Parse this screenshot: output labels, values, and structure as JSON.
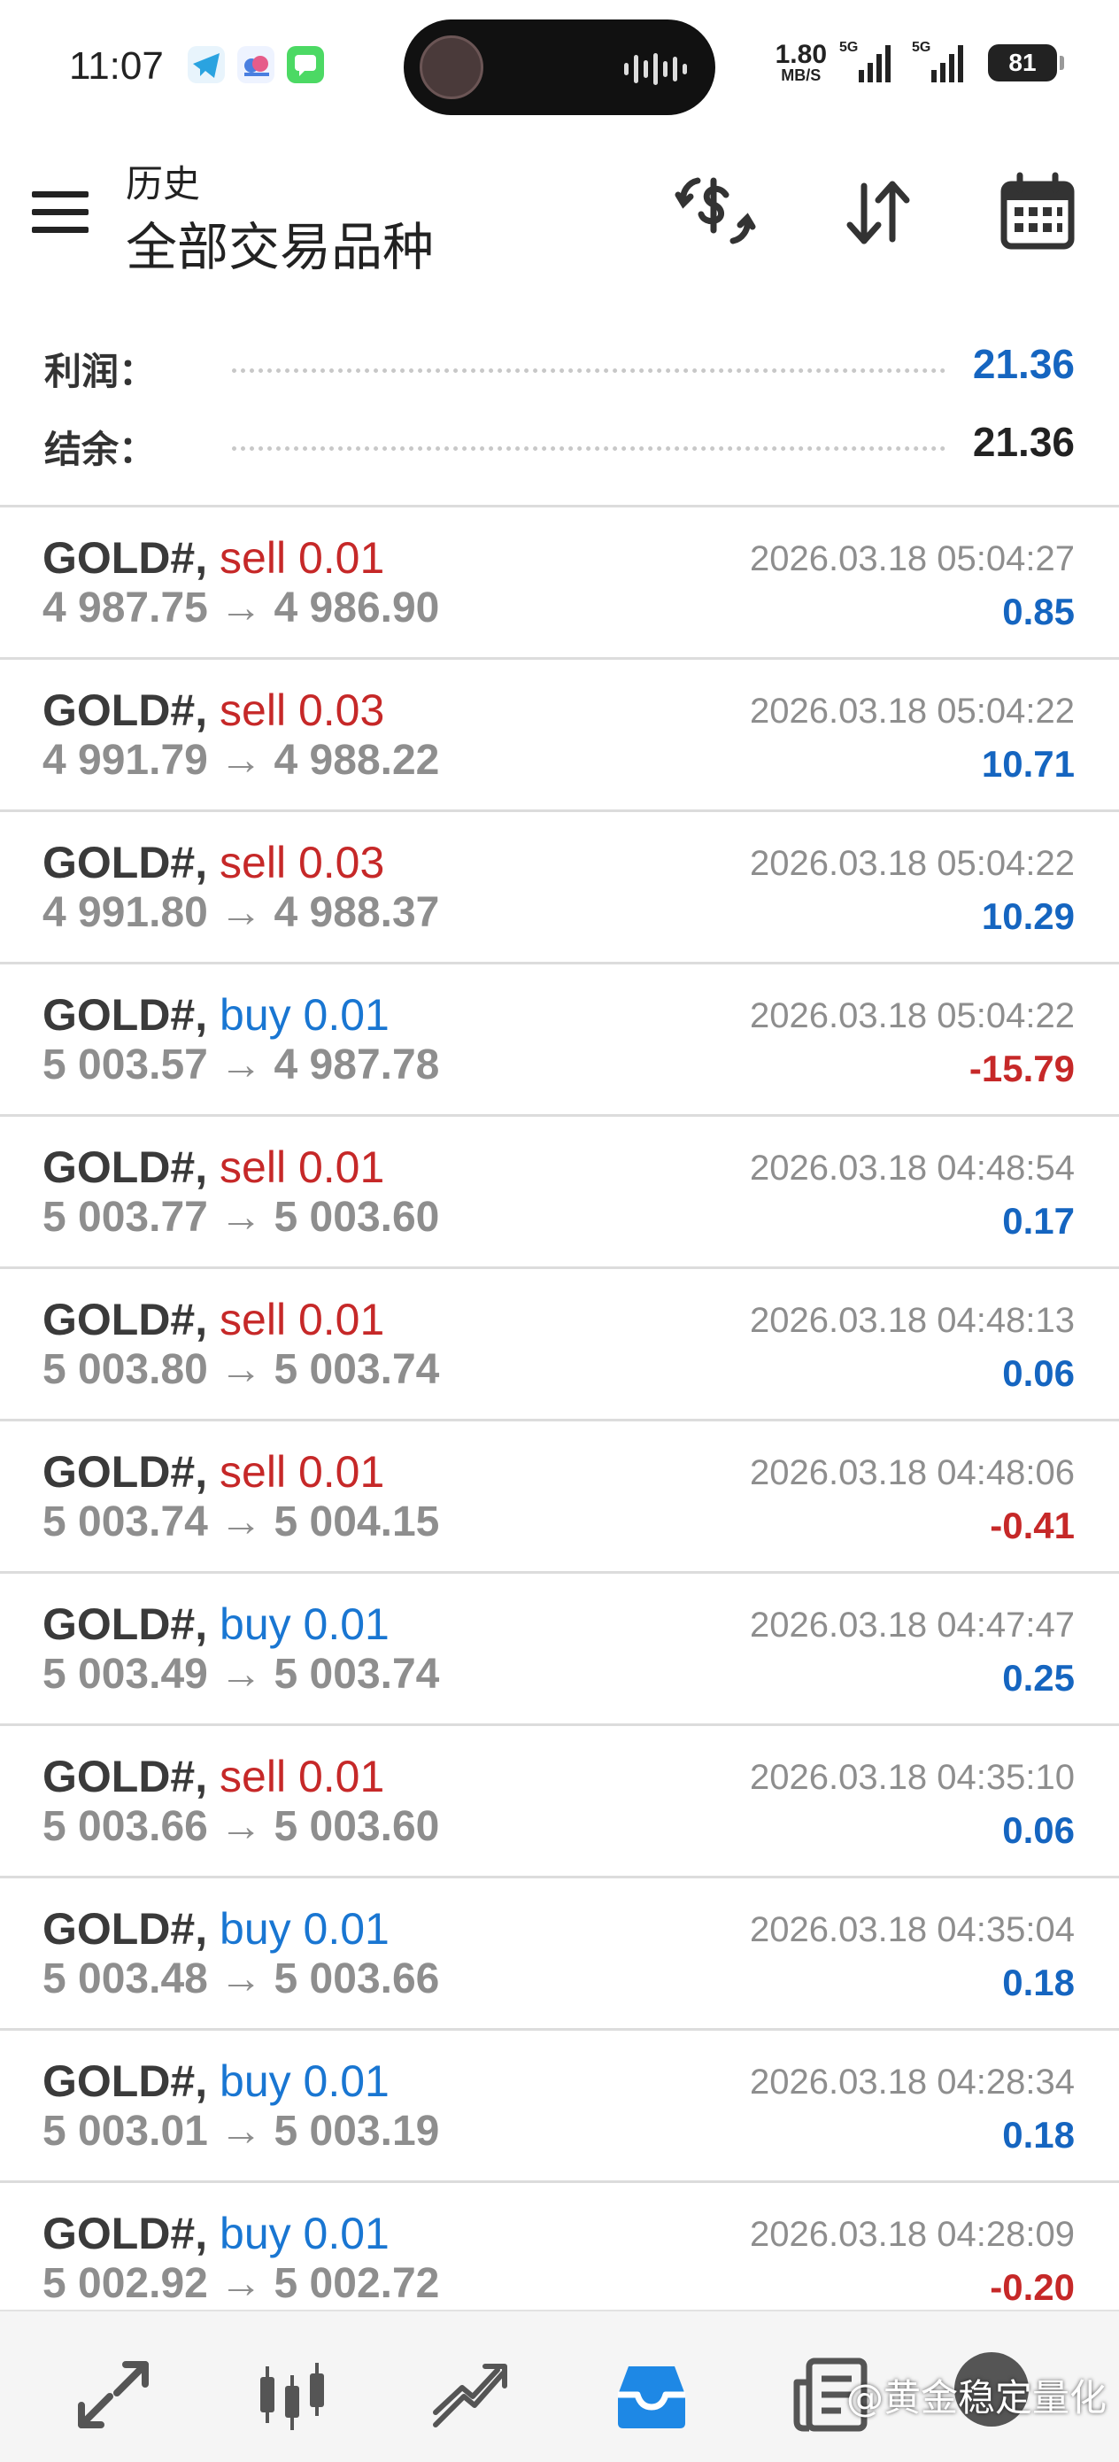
{
  "status_bar": {
    "time": "11:07",
    "net_speed_value": "1.80",
    "net_speed_unit": "MB/S",
    "signal1_label": "5G",
    "signal2_label": "5G",
    "battery": "81"
  },
  "toolbar": {
    "subtitle": "历史",
    "title": "全部交易品种",
    "icons": [
      "menu-icon",
      "currency-exchange-icon",
      "sort-icon",
      "calendar-icon"
    ]
  },
  "summary": {
    "profit_label": "利润：",
    "profit_value": "21.36",
    "balance_label": "结余：",
    "balance_value": "21.36"
  },
  "colors": {
    "sell": "#c62828",
    "buy": "#1976d2",
    "positive": "#1565c0",
    "negative": "#c62828",
    "active_nav": "#1e88e5"
  },
  "trades": [
    {
      "symbol": "GOLD#,",
      "side": "sell",
      "volume": "sell 0.01",
      "prices": "4 987.75 → 4 986.90",
      "time": "2026.03.18 05:04:27",
      "profit": "0.85",
      "sign": "positive"
    },
    {
      "symbol": "GOLD#,",
      "side": "sell",
      "volume": "sell 0.03",
      "prices": "4 991.79 → 4 988.22",
      "time": "2026.03.18 05:04:22",
      "profit": "10.71",
      "sign": "positive"
    },
    {
      "symbol": "GOLD#,",
      "side": "sell",
      "volume": "sell 0.03",
      "prices": "4 991.80 → 4 988.37",
      "time": "2026.03.18 05:04:22",
      "profit": "10.29",
      "sign": "positive"
    },
    {
      "symbol": "GOLD#,",
      "side": "buy",
      "volume": "buy 0.01",
      "prices": "5 003.57 → 4 987.78",
      "time": "2026.03.18 05:04:22",
      "profit": "-15.79",
      "sign": "negative"
    },
    {
      "symbol": "GOLD#,",
      "side": "sell",
      "volume": "sell 0.01",
      "prices": "5 003.77 → 5 003.60",
      "time": "2026.03.18 04:48:54",
      "profit": "0.17",
      "sign": "positive"
    },
    {
      "symbol": "GOLD#,",
      "side": "sell",
      "volume": "sell 0.01",
      "prices": "5 003.80 → 5 003.74",
      "time": "2026.03.18 04:48:13",
      "profit": "0.06",
      "sign": "positive"
    },
    {
      "symbol": "GOLD#,",
      "side": "sell",
      "volume": "sell 0.01",
      "prices": "5 003.74 → 5 004.15",
      "time": "2026.03.18 04:48:06",
      "profit": "-0.41",
      "sign": "negative"
    },
    {
      "symbol": "GOLD#,",
      "side": "buy",
      "volume": "buy 0.01",
      "prices": "5 003.49 → 5 003.74",
      "time": "2026.03.18 04:47:47",
      "profit": "0.25",
      "sign": "positive"
    },
    {
      "symbol": "GOLD#,",
      "side": "sell",
      "volume": "sell 0.01",
      "prices": "5 003.66 → 5 003.60",
      "time": "2026.03.18 04:35:10",
      "profit": "0.06",
      "sign": "positive"
    },
    {
      "symbol": "GOLD#,",
      "side": "buy",
      "volume": "buy 0.01",
      "prices": "5 003.48 → 5 003.66",
      "time": "2026.03.18 04:35:04",
      "profit": "0.18",
      "sign": "positive"
    },
    {
      "symbol": "GOLD#,",
      "side": "buy",
      "volume": "buy 0.01",
      "prices": "5 003.01 → 5 003.19",
      "time": "2026.03.18 04:28:34",
      "profit": "0.18",
      "sign": "positive"
    },
    {
      "symbol": "GOLD#,",
      "side": "buy",
      "volume": "buy 0.01",
      "prices": "5 002.92 → 5 002.72",
      "time": "2026.03.18 04:28:09",
      "profit": "-0.20",
      "sign": "negative"
    }
  ],
  "bottom_nav": {
    "items": [
      "quotes-icon",
      "chart-icon",
      "trade-icon",
      "history-icon",
      "news-icon",
      "settings-icon"
    ],
    "active": "history-icon"
  },
  "watermark": "@黄金稳定量化"
}
